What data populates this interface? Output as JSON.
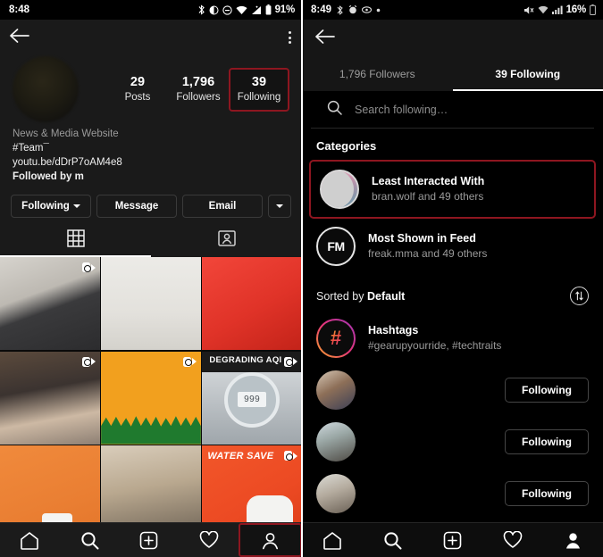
{
  "left": {
    "statusbar": {
      "time": "8:48",
      "battery": "91%",
      "icons": [
        "bluetooth-icon",
        "vibrate-icon",
        "dnd-icon",
        "wifi-icon",
        "signal-icon",
        "battery-icon"
      ]
    },
    "topbar": {
      "back": "back-arrow-icon",
      "menu": "kebab-menu-icon"
    },
    "stats": [
      {
        "num": "29",
        "label": "Posts",
        "highlighted": false
      },
      {
        "num": "1,796",
        "label": "Followers",
        "highlighted": false
      },
      {
        "num": "39",
        "label": "Following",
        "highlighted": true
      }
    ],
    "bio": {
      "category": "News & Media Website",
      "line1": "#Team¯",
      "line2": "youtu.be/dDrP7oAM4e8",
      "line3": "Followed by m"
    },
    "actions": {
      "following": "Following",
      "message": "Message",
      "email": "Email",
      "more": "chevron-down-icon"
    },
    "view_tabs": [
      {
        "name": "grid-view-tab",
        "active": true
      },
      {
        "name": "tagged-view-tab",
        "active": false
      }
    ],
    "grid": [
      {
        "label": "",
        "style": "img-a",
        "reel": true
      },
      {
        "label": "",
        "style": "img-b",
        "reel": false
      },
      {
        "label": "",
        "style": "img-c",
        "reel": false
      },
      {
        "label": "",
        "style": "img-d",
        "reel": true
      },
      {
        "label": "",
        "style": "img-e",
        "reel": true
      },
      {
        "label": "DEGRADING AQI",
        "style": "img-f",
        "reel": true
      },
      {
        "label": "",
        "style": "img-g",
        "reel": false
      },
      {
        "label": "",
        "style": "img-h",
        "reel": false
      },
      {
        "label": "WATER SAVE",
        "style": "img-i",
        "reel": true
      }
    ],
    "grid_dial_value": "999",
    "bottomnav": [
      {
        "name": "nav-home",
        "icon": "home-icon",
        "highlighted": false
      },
      {
        "name": "nav-search",
        "icon": "search-icon",
        "highlighted": false
      },
      {
        "name": "nav-create",
        "icon": "plus-box-icon",
        "highlighted": false
      },
      {
        "name": "nav-activity",
        "icon": "heart-icon",
        "highlighted": false
      },
      {
        "name": "nav-profile",
        "icon": "person-icon",
        "highlighted": true
      }
    ]
  },
  "right": {
    "statusbar": {
      "time": "8:49",
      "battery": "16%",
      "icons": [
        "bluetooth-icon",
        "alarm-icon",
        "eye-icon",
        "dot-icon",
        "mute-icon",
        "wifi-icon",
        "signal-icon",
        "battery-icon"
      ]
    },
    "topbar": {
      "back": "back-arrow-icon"
    },
    "tabs": [
      {
        "label": "1,796 Followers",
        "active": false
      },
      {
        "label": "39 Following",
        "active": true
      }
    ],
    "search": {
      "placeholder": "Search following…",
      "value": "",
      "icon": "search-icon"
    },
    "categories_title": "Categories",
    "categories": [
      {
        "title": "Least Interacted With",
        "subtitle": "bran.wolf and 49 others",
        "avatar": "stacked-photo-avatar",
        "highlighted": true
      },
      {
        "title": "Most Shown in Feed",
        "subtitle": "freak.mma and 49 others",
        "avatar": "fm-logo-avatar",
        "highlighted": false
      }
    ],
    "sort": {
      "prefix": "Sorted by ",
      "value": "Default",
      "icon": "sort-toggle-icon"
    },
    "list": [
      {
        "name": "Hashtags",
        "sub": "#gearupyourride, #techtraits",
        "avatar": "hashtag-icon",
        "button": ""
      },
      {
        "name": "",
        "sub": "",
        "avatar": "user-photo-1",
        "button": "Following"
      },
      {
        "name": "",
        "sub": "",
        "avatar": "user-photo-2",
        "button": "Following"
      },
      {
        "name": "",
        "sub": "",
        "avatar": "user-photo-3",
        "button": "Following"
      }
    ],
    "bottomnav": [
      {
        "name": "nav-home",
        "icon": "home-icon",
        "highlighted": false
      },
      {
        "name": "nav-search",
        "icon": "search-icon",
        "highlighted": false
      },
      {
        "name": "nav-create",
        "icon": "plus-box-icon",
        "highlighted": false
      },
      {
        "name": "nav-activity",
        "icon": "heart-icon",
        "highlighted": false
      },
      {
        "name": "nav-profile",
        "icon": "person-filled-icon",
        "highlighted": false
      }
    ]
  },
  "colors": {
    "highlight": "#8e1620",
    "accent": "#ffffff",
    "bg": "#000000"
  }
}
